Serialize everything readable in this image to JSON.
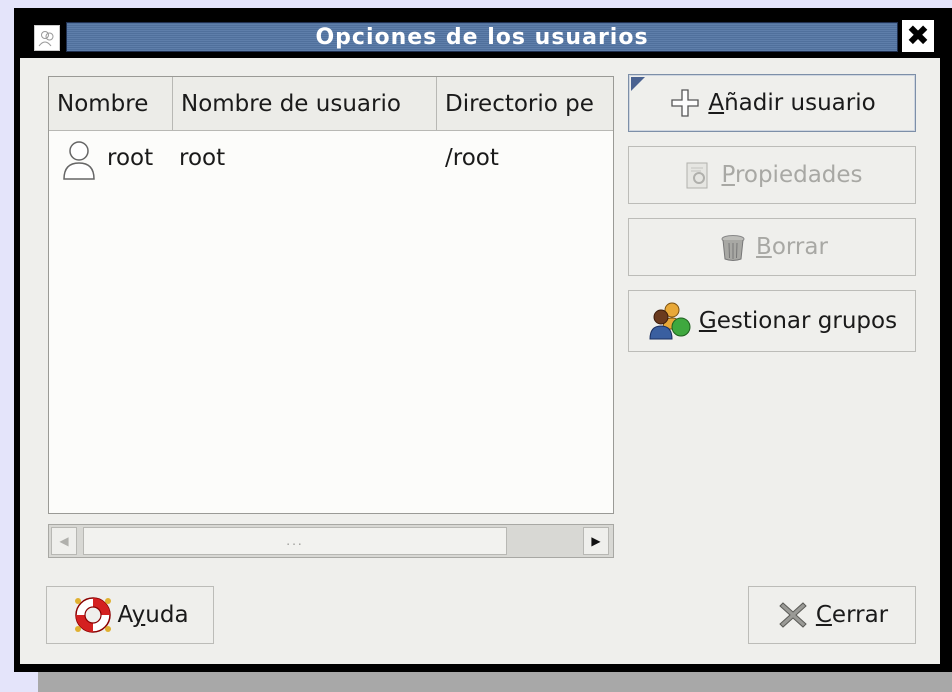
{
  "window": {
    "title": "Opciones de los usuarios"
  },
  "table": {
    "columns": [
      "Nombre",
      "Nombre de usuario",
      "Directorio pe"
    ],
    "rows": [
      {
        "name": "root",
        "username": "root",
        "home": "/root"
      }
    ]
  },
  "scrollbar": {
    "grip": "...",
    "left_arrow": "◀",
    "right_arrow": "▶"
  },
  "buttons": {
    "add_user": {
      "mnemonic": "A",
      "rest": "ñadir usuario"
    },
    "properties": {
      "mnemonic": "P",
      "rest": "ropiedades"
    },
    "delete": {
      "mnemonic": "B",
      "rest": "orrar"
    },
    "manage_groups": {
      "mnemonic": "G",
      "rest": "estionar grupos"
    },
    "help": {
      "before": "A",
      "mnemonic": "y",
      "rest": "uda"
    },
    "close": {
      "mnemonic": "C",
      "rest": "errar"
    }
  },
  "close_glyph": "✖",
  "icons": {
    "window": "users-icon",
    "add": "plus-icon",
    "properties": "properties-icon",
    "delete": "trash-icon",
    "groups": "groups-icon",
    "help": "lifebuoy-icon",
    "close": "x-icon",
    "user": "user-icon"
  },
  "colors": {
    "titlebar": "#5e7eaa",
    "background": "#e4e4fa",
    "dialog": "#efefec"
  }
}
